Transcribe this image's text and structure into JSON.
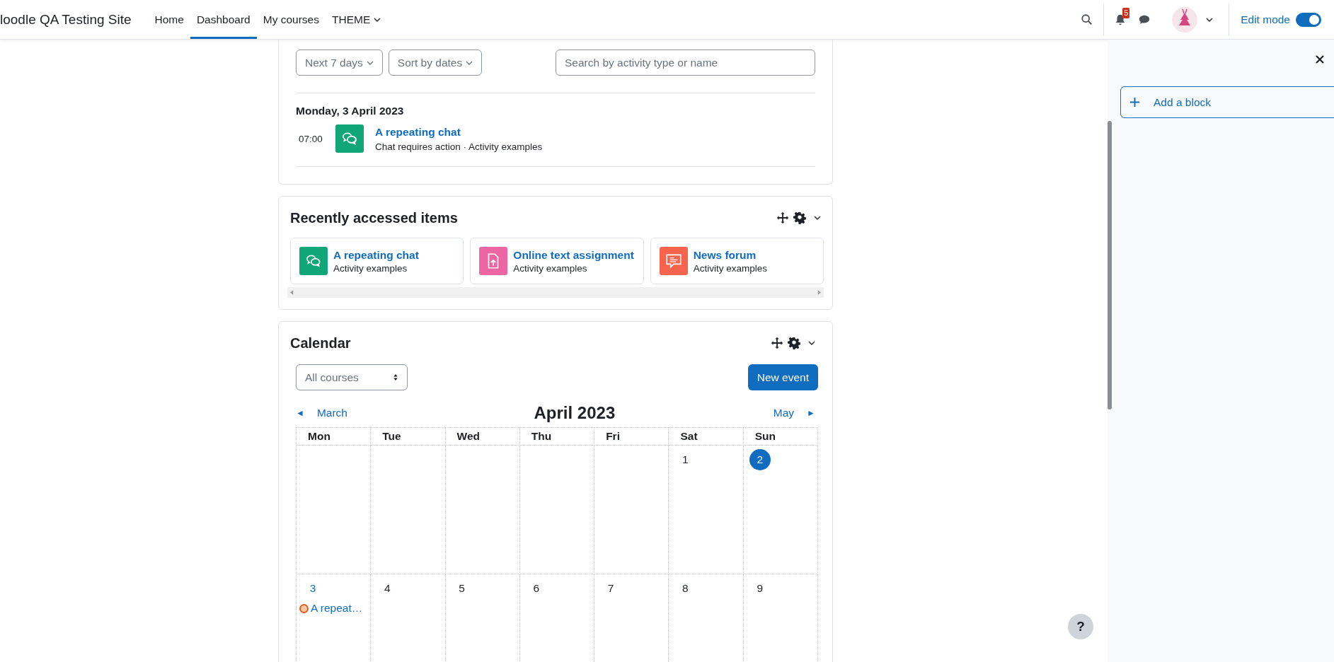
{
  "navbar": {
    "site_name": "loodle QA Testing Site",
    "nav_items": [
      {
        "label": "Home",
        "selected": false,
        "has_menu": false
      },
      {
        "label": "Dashboard",
        "selected": true,
        "has_menu": false
      },
      {
        "label": "My courses",
        "selected": false,
        "has_menu": false
      },
      {
        "label": "THEME",
        "selected": false,
        "has_menu": true
      }
    ],
    "notification_count": "5",
    "edit_mode": {
      "label": "Edit mode",
      "on": true
    }
  },
  "timeline": {
    "filters": [
      {
        "label": "Next 7 days"
      },
      {
        "label": "Sort by dates"
      }
    ],
    "search": {
      "placeholder": "Search by activity type or name"
    },
    "date_heading": "Monday, 3 April 2023",
    "events": [
      {
        "time": "07:00",
        "kind": "chat",
        "title": "A repeating chat",
        "detail": "Chat requires action · Activity examples"
      }
    ]
  },
  "recent": {
    "title": "Recently accessed items",
    "items": [
      {
        "kind": "chat",
        "title": "A repeating chat",
        "course": "Activity examples"
      },
      {
        "kind": "assignment",
        "title": "Online text assignment",
        "course": "Activity examples"
      },
      {
        "kind": "forum",
        "title": "News forum",
        "course": "Activity examples"
      }
    ]
  },
  "calendar": {
    "title": "Calendar",
    "course_select": "All courses",
    "new_event": "New event",
    "prev_icon": "◄",
    "prev_month": "March",
    "month": "April 2023",
    "next_month": "May",
    "next_icon": "►",
    "weekdays": [
      "Mon",
      "Tue",
      "Wed",
      "Thu",
      "Fri",
      "Sat",
      "Sun"
    ],
    "weeks": [
      [
        {
          "kind": "empty"
        },
        {
          "kind": "empty"
        },
        {
          "kind": "empty"
        },
        {
          "kind": "empty"
        },
        {
          "kind": "empty"
        },
        {
          "day": "1",
          "today": false
        },
        {
          "day": "2",
          "today": true
        }
      ],
      [
        {
          "day": "3",
          "today": false,
          "events": [
            {
              "title": "A repeat…"
            }
          ]
        },
        {
          "day": "4",
          "today": false
        },
        {
          "day": "5",
          "today": false
        },
        {
          "day": "6",
          "today": false
        },
        {
          "day": "7",
          "today": false
        },
        {
          "day": "8",
          "today": false
        },
        {
          "day": "9",
          "today": false
        }
      ]
    ]
  },
  "drawer": {
    "add_block": "Add a block"
  },
  "help": "?"
}
